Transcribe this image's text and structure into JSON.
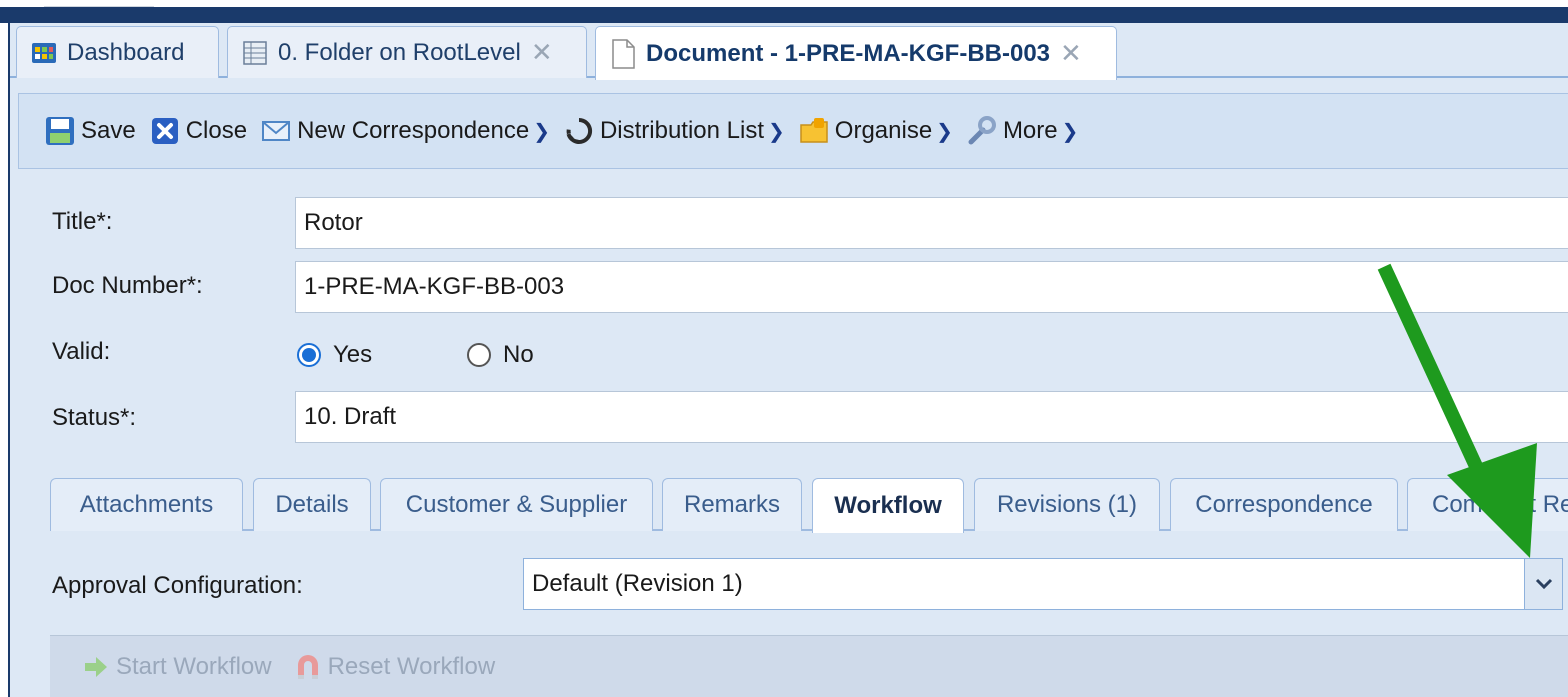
{
  "top_tabs": [
    {
      "label": "Dashboard",
      "icon": "dashboard-icon",
      "closable": false
    },
    {
      "label": "0. Folder on RootLevel",
      "icon": "folder-grid-icon",
      "closable": true
    },
    {
      "label": "Document - 1-PRE-MA-KGF-BB-003",
      "icon": "document-icon",
      "closable": true,
      "active": true
    }
  ],
  "close_glyph": "✕",
  "toolbar": {
    "save": "Save",
    "close": "Close",
    "new_correspondence": "New Correspondence",
    "distribution_list": "Distribution List",
    "organise": "Organise",
    "more": "More"
  },
  "form": {
    "title_label": "Title*:",
    "title_value": "Rotor",
    "doc_number_label": "Doc Number*:",
    "doc_number_value": "1-PRE-MA-KGF-BB-003",
    "valid_label": "Valid:",
    "valid_yes": "Yes",
    "valid_no": "No",
    "valid_selected": "Yes",
    "status_label": "Status*:",
    "status_value": "10. Draft"
  },
  "inner_tabs": [
    {
      "label": "Attachments"
    },
    {
      "label": "Details"
    },
    {
      "label": "Customer & Supplier"
    },
    {
      "label": "Remarks"
    },
    {
      "label": "Workflow",
      "active": true
    },
    {
      "label": "Revisions (1)"
    },
    {
      "label": "Correspondence"
    },
    {
      "label": "Comment Re"
    }
  ],
  "workflow": {
    "approval_label": "Approval Configuration:",
    "approval_value": "Default (Revision 1)",
    "start_workflow": "Start Workflow",
    "reset_workflow": "Reset Workflow"
  },
  "colors": {
    "header": "#1a3a6b",
    "panel": "#dde8f5",
    "accent_blue": "#1a6fd6",
    "annotation_arrow": "#1e9a1e"
  }
}
